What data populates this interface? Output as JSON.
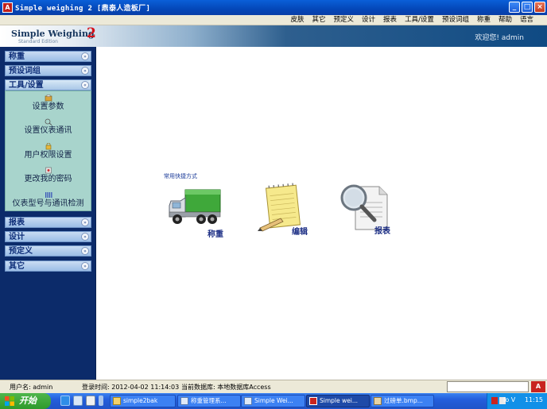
{
  "window": {
    "title": "Simple weighing 2 [鼎泰人造板厂]",
    "app_icon_text": "A",
    "buttons": [
      "_",
      "□",
      "×"
    ]
  },
  "menubar": {
    "items": [
      "皮肤",
      "其它",
      "预定义",
      "设计",
      "报表",
      "工具/设置",
      "预设词组",
      "称重",
      "帮助",
      "语言"
    ]
  },
  "banner": {
    "logo_text": "Simple Weighing",
    "logo_number": "2",
    "edition": "Standard Edition",
    "welcome": "欢迎您! admin"
  },
  "sidebar": {
    "categories_top": [
      {
        "label": "称重",
        "chevron": "»"
      },
      {
        "label": "预设词组",
        "chevron": "»"
      },
      {
        "label": "工具/设置",
        "chevron": "«"
      }
    ],
    "subitems": [
      {
        "label": "设置参数",
        "icon": "settings-icon"
      },
      {
        "label": "设置仪表通讯",
        "icon": "communication-icon"
      },
      {
        "label": "用户权限设置",
        "icon": "user-permission-icon"
      },
      {
        "label": "更改我的密码",
        "icon": "password-icon"
      },
      {
        "label": "仪表型号与通讯检测",
        "icon": "instrument-test-icon"
      }
    ],
    "categories_bottom": [
      {
        "label": "报表",
        "chevron": "»"
      },
      {
        "label": "设计",
        "chevron": "»"
      },
      {
        "label": "预定义",
        "chevron": "»"
      },
      {
        "label": "其它",
        "chevron": "»"
      }
    ]
  },
  "main": {
    "shortcut_title": "常用快捷方式",
    "shortcuts": [
      {
        "label": "称重",
        "icon": "truck-icon"
      },
      {
        "label": "编辑",
        "icon": "notepad-pencil-icon"
      },
      {
        "label": "报表",
        "icon": "magnifier-document-icon"
      }
    ]
  },
  "statusbar": {
    "username": "用户名: admin",
    "login_time": "登录时间: 2012-04-02 11:14:03",
    "database": "当前数据库: 本地数据库Access",
    "brand": "A"
  },
  "taskbar": {
    "start_label": "开始",
    "tasks": [
      {
        "label": "simple2bak",
        "icon": "folder-icon",
        "active": false
      },
      {
        "label": "称重管理系...",
        "icon": "window-icon",
        "active": false
      },
      {
        "label": "Simple Wei...",
        "icon": "window-icon",
        "active": false
      },
      {
        "label": "Simple wei...",
        "icon": "app-icon",
        "active": true
      },
      {
        "label": "过磅单.bmp...",
        "icon": "image-icon",
        "active": false
      }
    ],
    "tray_text": "Io V",
    "clock": "11:15"
  }
}
